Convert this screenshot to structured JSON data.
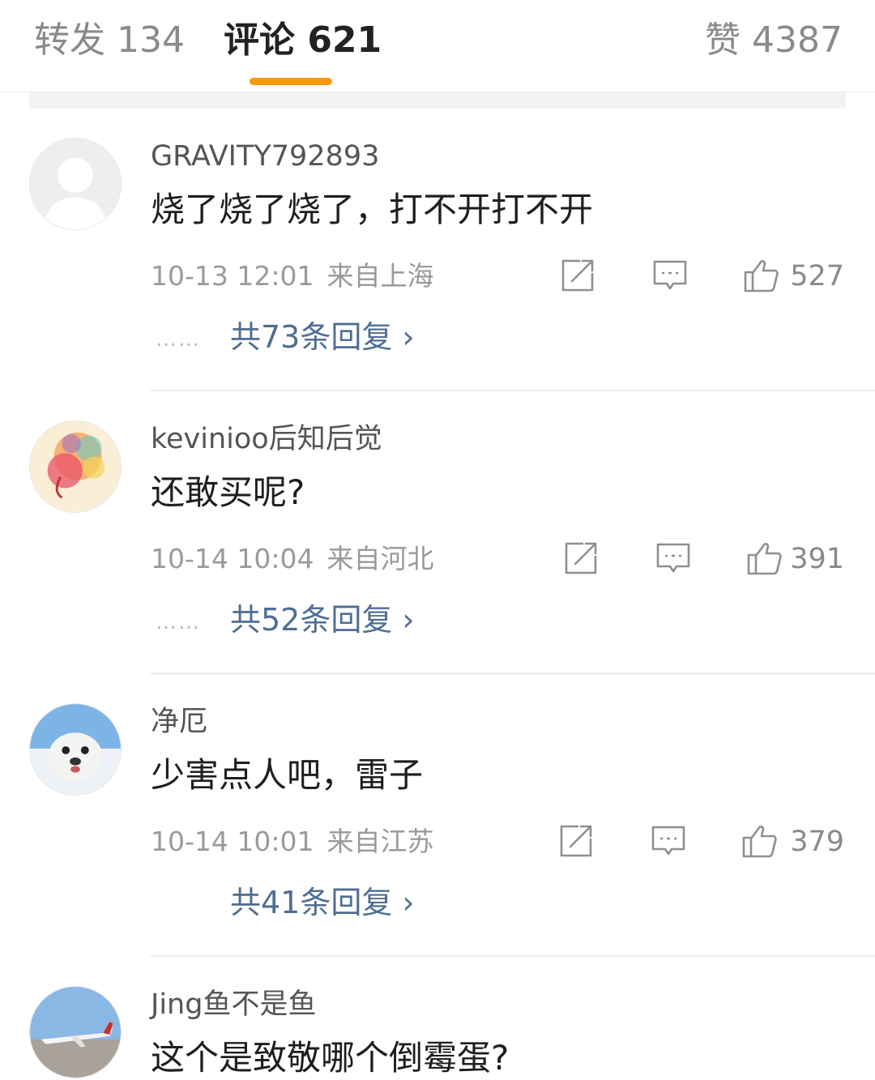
{
  "tabs": {
    "repost": "转发 134",
    "comment": "评论 621",
    "like": "赞 4387"
  },
  "colors": {
    "accent": "#f99a0e",
    "link": "#4f6e93"
  },
  "comments": [
    {
      "username": "GRAVITY792893",
      "content": "烧了烧了烧了，打不开打不开",
      "date": "10-13 12:01",
      "location": "来自上海",
      "likes": "527",
      "replies": "共73条回复 ›",
      "dots": "……",
      "avatar_icon": "default-user-avatar"
    },
    {
      "username": "kevinioo后知后觉",
      "content": "还敢买呢?",
      "date": "10-14 10:04",
      "location": "来自河北",
      "likes": "391",
      "replies": "共52条回复 ›",
      "dots": "……",
      "avatar_icon": "watercolor-portrait-avatar"
    },
    {
      "username": "净厄",
      "content": "少害点人吧，雷子",
      "date": "10-14 10:01",
      "location": "来自江苏",
      "likes": "379",
      "replies": "共41条回复 ›",
      "dots": "",
      "avatar_icon": "seal-avatar"
    },
    {
      "username": "Jing鱼不是鱼",
      "content": "这个是致敬哪个倒霉蛋?",
      "avatar_icon": "airplane-avatar"
    }
  ]
}
